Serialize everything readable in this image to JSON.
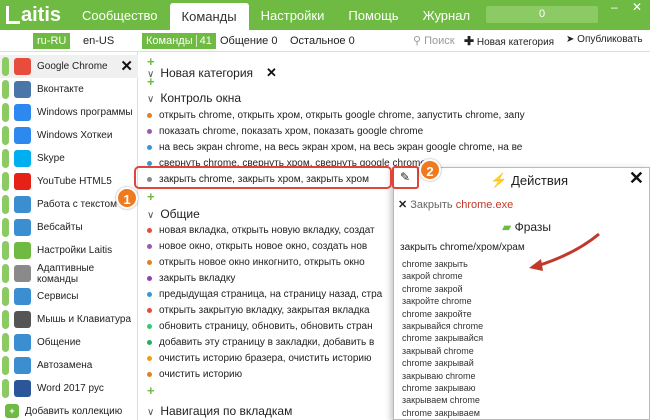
{
  "app": {
    "logo": "aitis",
    "nav": [
      "Сообщество",
      "Команды",
      "Настройки",
      "Помощь",
      "Журнал"
    ],
    "counter": "0",
    "win_minimize": "–",
    "win_close": "✕"
  },
  "subbar": {
    "langs": [
      "ru-RU",
      "en-US"
    ],
    "tabs": [
      {
        "label": "Команды",
        "count": "41"
      },
      {
        "label": "Общение",
        "count": "0"
      },
      {
        "label": "Остальное",
        "count": "0"
      }
    ],
    "search_placeholder": "Поиск",
    "new_category": "Новая категория",
    "publish": "Опубликовать"
  },
  "sidebar": {
    "items": [
      {
        "label": "Google Chrome",
        "icon": "chrome-icon",
        "color": "#e74c3c"
      },
      {
        "label": "Вконтакте",
        "icon": "vk-icon",
        "color": "#4a76a8"
      },
      {
        "label": "Windows программы",
        "icon": "windows-icon",
        "color": "#2d89ef"
      },
      {
        "label": "Windows Хоткеи",
        "icon": "windows-icon",
        "color": "#2d89ef"
      },
      {
        "label": "Skype",
        "icon": "skype-icon",
        "color": "#00aff0"
      },
      {
        "label": "YouTube HTML5",
        "icon": "youtube-icon",
        "color": "#e62117"
      },
      {
        "label": "Работа с текстом",
        "icon": "text-icon",
        "color": "#3b8ed0"
      },
      {
        "label": "Вебсайты",
        "icon": "websites-icon",
        "color": "#3b8ed0"
      },
      {
        "label": "Настройки Laitis",
        "icon": "laitis-icon",
        "color": "#6fba43"
      },
      {
        "label": "Адаптивные команды",
        "icon": "adaptive-icon",
        "color": "#8a8a8a"
      },
      {
        "label": "Сервисы",
        "icon": "services-icon",
        "color": "#3b8ed0"
      },
      {
        "label": "Мышь и Клавиатура",
        "icon": "mouse-icon",
        "color": "#555555"
      },
      {
        "label": "Общение",
        "icon": "chat-icon",
        "color": "#3b8ed0"
      },
      {
        "label": "Автозамена",
        "icon": "autoreplace-icon",
        "color": "#3b8ed0"
      },
      {
        "label": "Word 2017 рус",
        "icon": "word-icon",
        "color": "#2b579a"
      }
    ],
    "add_collection": "Добавить коллекцию"
  },
  "main": {
    "new_category_header": "Новая категория",
    "window_control_header": "Контроль окна",
    "window_commands": [
      "открыть chrome, открыть хром, открыть google chrome, запустить chrome, запу",
      "показать chrome, показать хром, показать google chrome",
      "на весь экран chrome, на весь экран хром, на весь экран google chrome, на ве",
      "свернуть chrome, свернуть хром, свернуть google chrome",
      "закрыть chrome, закрыть хром, закрыть хром"
    ],
    "general_header": "Общие",
    "general_commands": [
      "новая вкладка, открыть новую вкладку, создат",
      "новое окно, открыть новое окно, создать нов",
      "открыть новое окно инкогнито, открыть окно",
      "закрыть вкладку",
      "предыдущая страница, на страницу назад, стра",
      "открыть закрытую вкладку, закрытая вкладка",
      "обновить страницу, обновить, обновить стран",
      "добавить эту страницу в закладки, добавить в",
      "очистить историю бразера, очистить историю",
      "очистить историю"
    ],
    "tabs_nav_header": "Навигация по вкладкам"
  },
  "panel": {
    "title": "Действия",
    "close_action": "Закрыть",
    "close_app": "chrome.exe",
    "phrases_title": "Фразы",
    "main_phrase": "закрыть chrome/хром/храм",
    "phrases": [
      "chrome закрыть",
      "закрой chrome",
      "chrome закрой",
      "закройте chrome",
      "chrome закройте",
      "закрывайся chrome",
      "chrome закрывайся",
      "закрывай chrome",
      "chrome закрывай",
      "закрываю chrome",
      "chrome закрываю",
      "закрываем chrome",
      "chrome закрываем"
    ]
  },
  "annotations": {
    "badge1": "1",
    "badge2": "2"
  },
  "colors": {
    "accent": "#6fba43",
    "highlight": "#e0453a",
    "badge": "#f07a20"
  }
}
